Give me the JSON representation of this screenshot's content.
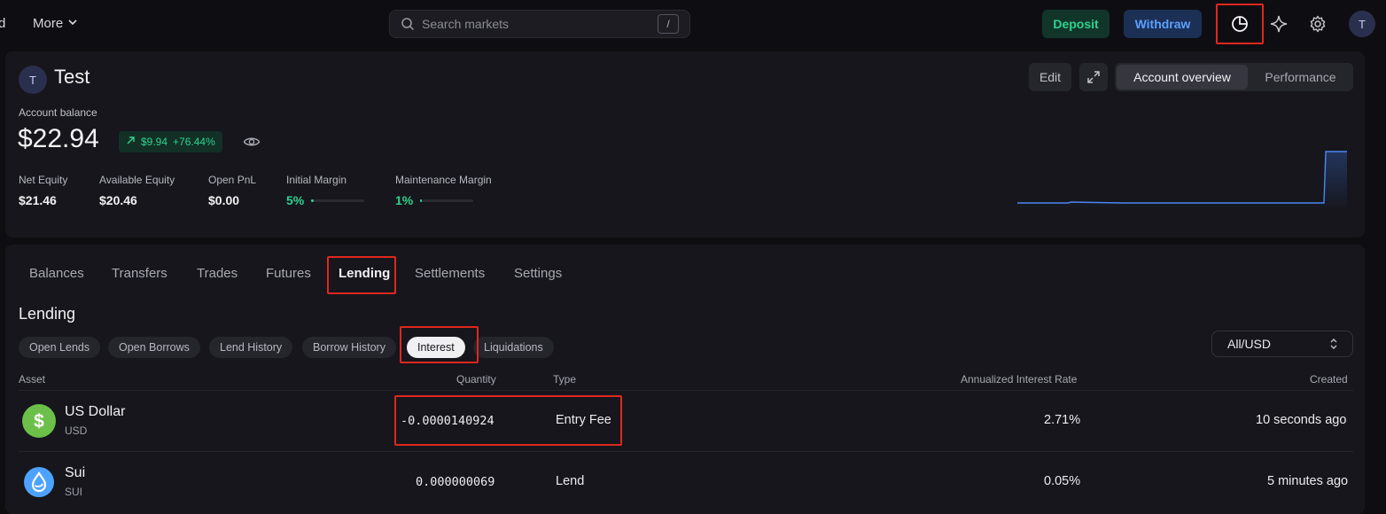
{
  "topbar": {
    "cut_label": "d",
    "more_label": "More",
    "search_placeholder": "Search markets",
    "search_shortcut": "/",
    "deposit_label": "Deposit",
    "withdraw_label": "Withdraw",
    "avatar_initial": "T"
  },
  "account": {
    "avatar_initial": "T",
    "name": "Test",
    "edit_label": "Edit",
    "view_tabs": [
      "Account overview",
      "Performance"
    ],
    "balance_label": "Account balance",
    "balance_value": "$22.94",
    "balance_change": "$9.94",
    "balance_change_pct": "+76.44%",
    "metrics": {
      "net_equity": {
        "label": "Net Equity",
        "value": "$21.46"
      },
      "available_equity": {
        "label": "Available Equity",
        "value": "$20.46"
      },
      "open_pnl": {
        "label": "Open PnL",
        "value": "$0.00"
      },
      "initial_margin": {
        "label": "Initial Margin",
        "value": "5%",
        "level": 0.05
      },
      "maintenance_margin": {
        "label": "Maintenance Margin",
        "value": "1%",
        "level": 0.01
      }
    }
  },
  "tabs": [
    "Balances",
    "Transfers",
    "Trades",
    "Futures",
    "Lending",
    "Settlements",
    "Settings"
  ],
  "lending": {
    "title": "Lending",
    "filters": [
      "Open Lends",
      "Open Borrows",
      "Lend History",
      "Borrow History",
      "Interest",
      "Liquidations"
    ],
    "market_select": "All/USD",
    "columns": {
      "asset": "Asset",
      "quantity": "Quantity",
      "type": "Type",
      "rate": "Annualized Interest Rate",
      "created": "Created"
    },
    "rows": [
      {
        "name": "US Dollar",
        "symbol": "USD",
        "quantity": "-0.0000140924",
        "type": "Entry Fee",
        "rate": "2.71%",
        "created": "10 seconds ago"
      },
      {
        "name": "Sui",
        "symbol": "SUI",
        "quantity": "0.000000069",
        "type": "Lend",
        "rate": "0.05%",
        "created": "5 minutes ago"
      }
    ]
  },
  "colors": {
    "accent_green": "#2fd28f",
    "accent_blue": "#5aa0ff",
    "highlight_red": "#e0271e"
  }
}
